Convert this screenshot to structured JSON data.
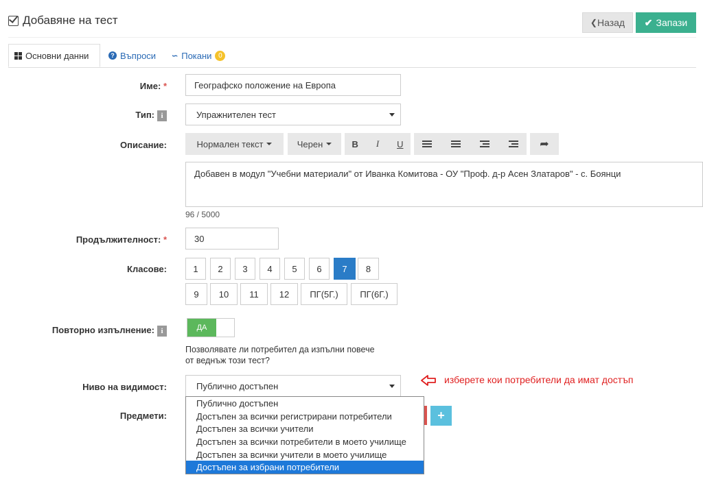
{
  "header": {
    "title": "Добавяне на тест",
    "back_label": "Назад",
    "save_label": "Запази"
  },
  "tabs": [
    {
      "label": "Основни данни"
    },
    {
      "label": "Въпроси"
    },
    {
      "label": "Покани",
      "badge": "0"
    }
  ],
  "form": {
    "name_label": "Име:",
    "name_value": "Географско положение на Европа",
    "type_label": "Тип:",
    "type_value": "Упражнителен тест",
    "description_label": "Описание:",
    "editor": {
      "format_label": "Нормален текст",
      "color_label": "Черен",
      "bold": "B",
      "italic": "I",
      "underline": "U"
    },
    "description_value": "Добавен в модул \"Учебни материали\" от Иванка Комитова - ОУ \"Проф. д-р Асен Златаров\" - с. Боянци",
    "char_count": "96 / 5000",
    "duration_label": "Продължителност:",
    "duration_value": "30",
    "grades_label": "Класове:",
    "grades": [
      "1",
      "2",
      "3",
      "4",
      "5",
      "6",
      "7",
      "8",
      "9",
      "10",
      "11",
      "12",
      "ПГ(5Г.)",
      "ПГ(6Г.)"
    ],
    "selected_grade": "7",
    "repeat_label": "Повторно изпълнение:",
    "repeat_toggle": "ДА",
    "repeat_help_1": "Позволявате ли потребител да изпълни повече",
    "repeat_help_2": "от веднъж този тест?",
    "visibility_label": "Ниво на видимост:",
    "visibility_value": "Публично достъпен",
    "visibility_options": [
      "Публично достъпен",
      "Достъпен за всички регистрирани потребители",
      "Достъпен за всички учители",
      "Достъпен за всички потребители в моето училище",
      "Достъпен за всички учители в моето училище",
      "Достъпен за избрани потребители"
    ],
    "visibility_highlighted": 5,
    "subjects_label": "Предмети:",
    "annotation": "изберете кои потребители да имат достъп"
  },
  "colors": {
    "primary": "#2a7cc7",
    "save": "#3bb08f",
    "toggle": "#5cb85c",
    "add": "#5bc0de",
    "annotation": "#e02020"
  }
}
